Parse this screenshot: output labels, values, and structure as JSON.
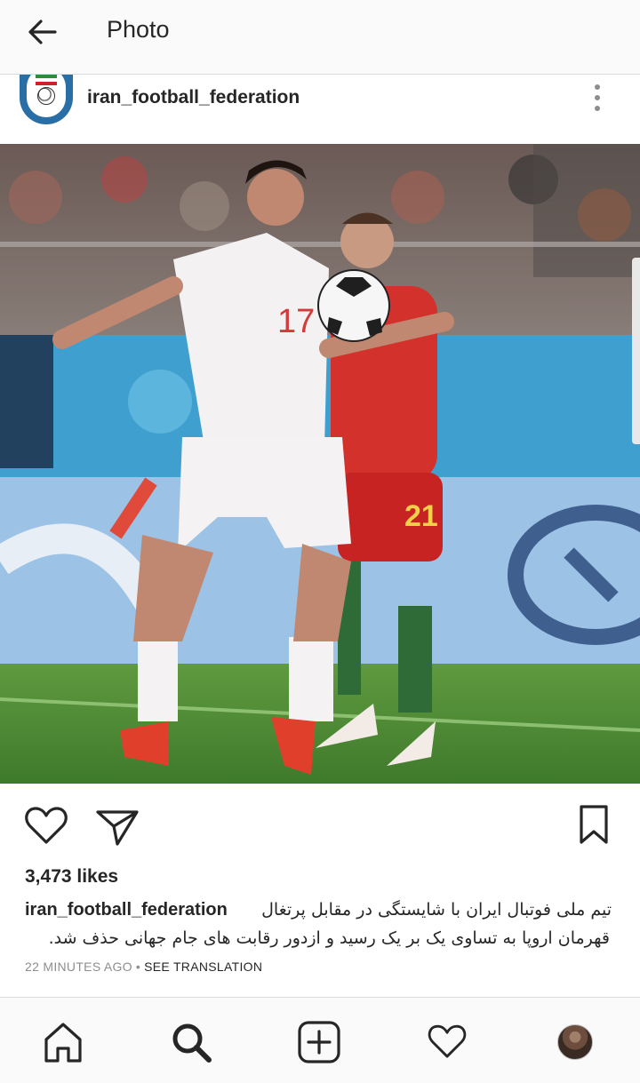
{
  "app_bar": {
    "title": "Photo",
    "back_icon": "arrow-left-icon"
  },
  "post": {
    "username": "iran_football_federation",
    "more_icon": "more-vertical-icon",
    "photo_icon": "football-photo",
    "jersey_numbers": {
      "white_player": "17",
      "red_player": "21"
    }
  },
  "actions": {
    "like_icon": "heart-icon",
    "share_icon": "send-icon",
    "save_icon": "bookmark-icon"
  },
  "likes": "3,473 likes",
  "caption": {
    "username": "iran_football_federation",
    "line1": "تیم ملی فوتبال ایران با شایستگی در مقابل پرتغال",
    "line2": "قهرمان اروپا به تساوی یک بر یک رسید و ازدور رقابت های جام جهانی حذف شد."
  },
  "meta": {
    "time": "22 MINUTES AGO",
    "separator": "•",
    "translate": "SEE TRANSLATION"
  },
  "bottom_nav": {
    "items": [
      "home-icon",
      "search-icon",
      "add-post-icon",
      "activity-heart-icon",
      "profile-avatar"
    ]
  },
  "colors": {
    "bar_bg": "#fafafa",
    "text": "#262626",
    "muted": "#8e8e8e",
    "divider": "#dbdbdb"
  }
}
